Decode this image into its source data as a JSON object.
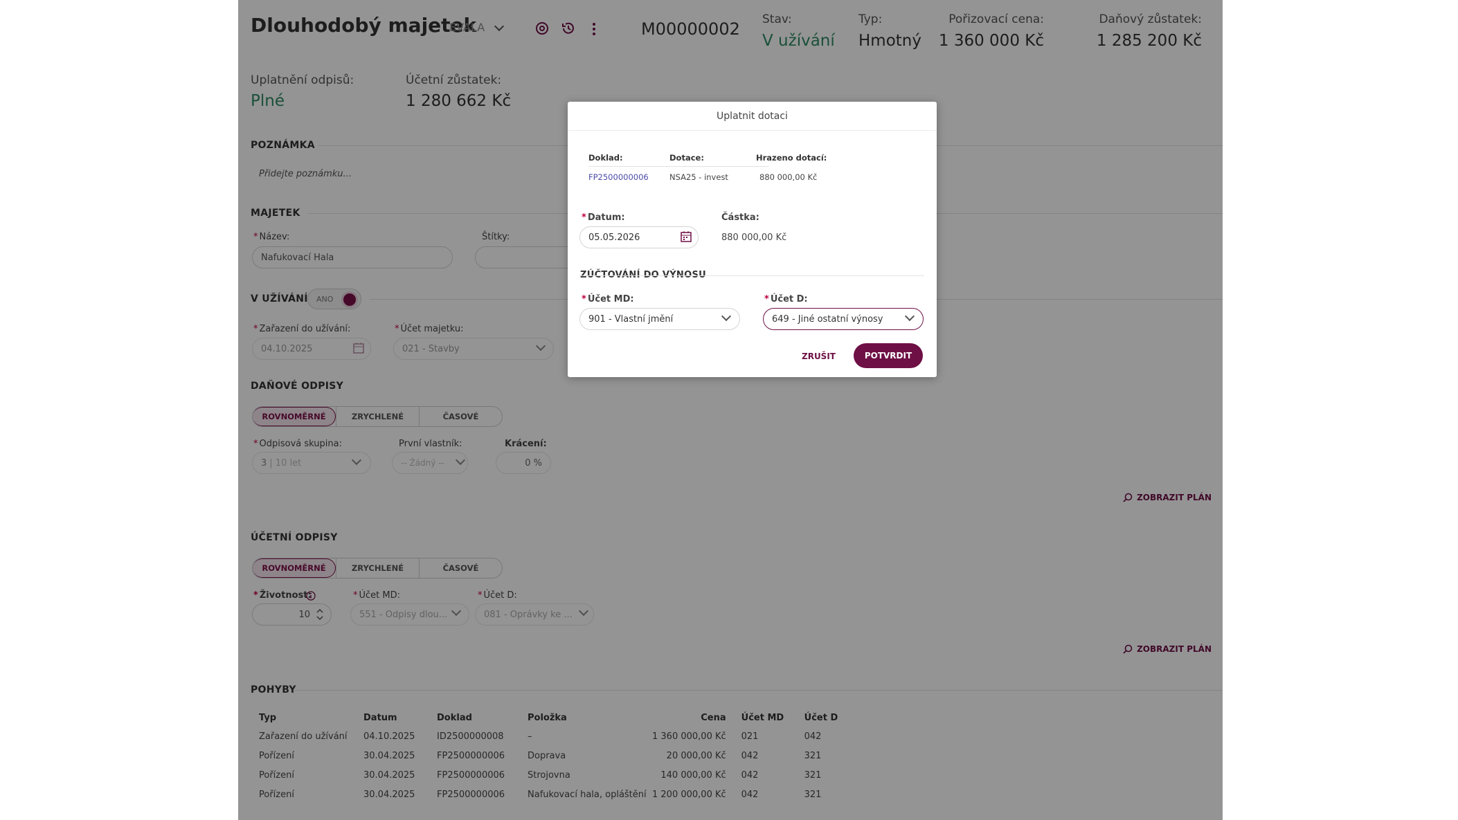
{
  "header": {
    "title": "Dlouhodobý majetek",
    "company": "EVALA",
    "code": "M00000002",
    "stats": [
      {
        "label": "Stav:",
        "value": "V užívání"
      },
      {
        "label": "Typ:",
        "value": "Hmotný"
      },
      {
        "label": "Pořizovací cena:",
        "value": "1 360 000 Kč"
      },
      {
        "label": "Daňový zůstatek:",
        "value": "1 285 200 Kč"
      }
    ],
    "uplatneni_label": "Uplatnění odpisů:",
    "uplatneni_value": "Plné",
    "ucetni_label": "Účetní zůstatek:",
    "ucetni_value": "1 280 662 Kč"
  },
  "note": {
    "title": "POZNÁMKA",
    "placeholder": "Přidejte poznámku..."
  },
  "majetek": {
    "title": "MAJETEK",
    "name_label": "Název:",
    "name_value": "Nafukovací Hala",
    "tags_label": "Štítky:"
  },
  "vuzivani": {
    "title": "V UŽÍVÁNÍ",
    "toggle": "ANO",
    "date_label": "Zařazení do užívání:",
    "date_value": "04.10.2025",
    "account_label": "Účet majetku:",
    "account_value": "021 - Stavby"
  },
  "danove": {
    "title": "DAŇOVÉ ODPISY",
    "tabs": [
      "ROVNOMĚRNÉ",
      "ZRYCHLENÉ",
      "ČASOVÉ"
    ],
    "group_label": "Odpisová skupina:",
    "group_value_a": "3",
    "group_value_b": "| 10 let",
    "owner_label": "První vlastník:",
    "owner_value": "-- Žádný --",
    "cut_label": "Krácení:",
    "cut_value": "0 %",
    "plan": "ZOBRAZIT PLÁN"
  },
  "ucetni": {
    "title": "ÚČETNÍ ODPISY",
    "tabs": [
      "ROVNOMĚRNÉ",
      "ZRYCHLENÉ",
      "ČASOVÉ"
    ],
    "life_label": "Životnost:",
    "life_value": "10",
    "md_label": "Účet MD:",
    "md_value": "551 - Odpisy dlou...",
    "d_label": "Účet D:",
    "d_value": "081 - Oprávky ke ...",
    "plan": "ZOBRAZIT PLÁN"
  },
  "pohyby": {
    "title": "POHYBY",
    "columns": [
      "Typ",
      "Datum",
      "Doklad",
      "Položka",
      "Cena",
      "Účet MD",
      "Účet D"
    ],
    "rows": [
      [
        "Zařazení do užívání",
        "04.10.2025",
        "ID2500000008",
        "–",
        "1 360 000,00 Kč",
        "021",
        "042"
      ],
      [
        "Pořízení",
        "30.04.2025",
        "FP2500000006",
        "Doprava",
        "20 000,00 Kč",
        "042",
        "321"
      ],
      [
        "Pořízení",
        "30.04.2025",
        "FP2500000006",
        "Strojovna",
        "140 000,00 Kč",
        "042",
        "321"
      ],
      [
        "Pořízení",
        "30.04.2025",
        "FP2500000006",
        "Nafukovací hala, opláštění",
        "1 200 000,00 Kč",
        "042",
        "321"
      ]
    ]
  },
  "modal": {
    "title": "Uplatnit dotaci",
    "cols": [
      "Doklad:",
      "Dotace:",
      "Hrazeno dotací:"
    ],
    "row": [
      "FP2500000006",
      "NSA25 - invest",
      "880 000,00 Kč"
    ],
    "date_label": "Datum:",
    "date_value": "05.05.2026",
    "amount_label": "Částka:",
    "amount_value": "880 000,00 Kč",
    "section": "ZÚČTOVÁNÍ DO VÝNOSU",
    "md_label": "Účet MD:",
    "md_value": "901 - Vlastní jmění",
    "d_label": "Účet D:",
    "d_value": "649 - Jiné ostatní výnosy",
    "cancel": "ZRUŠIT",
    "confirm": "POTVRDIT"
  },
  "colors": {
    "brand": "#6e0f45",
    "status_green": "#2e8a64",
    "link": "#4a4aa8"
  }
}
